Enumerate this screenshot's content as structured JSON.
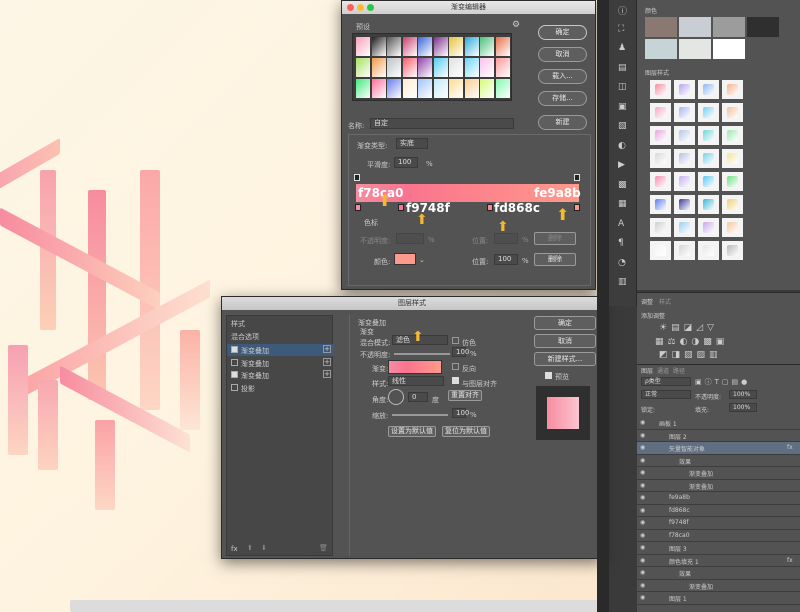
{
  "gradient_editor": {
    "title": "渐变编辑器",
    "presets_label": "预设",
    "name_label": "名称:",
    "name_value": "自定",
    "type_label": "渐变类型:",
    "type_value": "实底",
    "smooth_label": "平滑度:",
    "smooth_value": "100",
    "percent": "%",
    "btn_ok": "确定",
    "btn_cancel": "取消",
    "btn_load": "载入...",
    "btn_save": "存储...",
    "btn_new": "新建",
    "stops_label": "色标",
    "opacity_label": "不透明度:",
    "location_label": "位置:",
    "delete_label": "删除",
    "color_label": "颜色:",
    "location_value": "100",
    "overlay_left": "f78ca0",
    "overlay_right": "fe9a8b",
    "overlay_mid1": "f9748f",
    "overlay_mid2": "fd868c",
    "preset_colors": [
      "#f6a0b8",
      "#1e1e1e",
      "#555555",
      "#c94070",
      "#3b66d6",
      "#7d2f8f",
      "#e8c23a",
      "#2ca9d9",
      "#4cc07a",
      "#e7704e",
      "#a8e063",
      "#f2994a",
      "#bdc3c7",
      "#f45c6a",
      "#8e44ad",
      "#56ccf2",
      "#e1e1e1",
      "#6dd5fa",
      "#fbc2eb",
      "#ff9a9e",
      "#43e97b",
      "#fa709a",
      "#667eea",
      "#ffecd2",
      "#a1c4fd",
      "#c2e9fb",
      "#fddb92",
      "#fccb90",
      "#d4fc79",
      "#84fab0"
    ]
  },
  "layer_style": {
    "title": "图层样式",
    "styles_label": "样式",
    "blend_options": "混合选项",
    "items": [
      "渐变叠加",
      "渐变叠加",
      "渐变叠加",
      "投影"
    ],
    "section_title": "渐变叠加",
    "section_sub": "渐变",
    "blend_mode_label": "混合模式:",
    "blend_mode_value": "滤色",
    "dither_label": "仿色",
    "opacity_label": "不透明度:",
    "opacity_value": "100",
    "gradient_label": "渐变:",
    "reverse_label": "反向",
    "style_label": "样式:",
    "style_value": "线性",
    "align_label": "与图层对齐",
    "angle_label": "角度:",
    "angle_value": "0",
    "degree": "度",
    "reset_align": "重置对齐",
    "scale_label": "缩放:",
    "scale_value": "100",
    "percent": "%",
    "btn_default": "设置为默认值",
    "btn_reset_default": "复位为默认值",
    "btn_ok": "确定",
    "btn_cancel": "取消",
    "btn_new_style": "新建样式...",
    "preview_label": "预览",
    "fx_label": "fx"
  },
  "swatches_panel": {
    "title": "颜色",
    "styles_title": "图层样式",
    "swatch_colors": [
      "#8a7872",
      "#c9cdd4",
      "#9c9c9c",
      "#2f2f2f",
      "#c6d4d8",
      "#e4e6e4",
      "#ffffff"
    ],
    "style_colors": [
      "#f78ca0",
      "#b9a3f0",
      "#8fb8f0",
      "#f7b18b",
      "#f4a8c8",
      "#a7b7f0",
      "#76d0f0",
      "#f5c19a",
      "#e8a6e0",
      "#b6c6e6",
      "#6fd7d7",
      "#9ee8b0",
      "#d9d9d9",
      "#b7c1e8",
      "#7bd1ea",
      "#f6e39a",
      "#f88fb0",
      "#c6b0f0",
      "#5ec8f0",
      "#6fe08a",
      "#5a7cf0",
      "#3b3b9c",
      "#3bb7d8",
      "#f0d070",
      "#cfcfcf",
      "#9ad0f0",
      "#c8a8e8",
      "#f7c69a",
      "#f4f4f4",
      "#d6d6d6",
      "#e8e8e8",
      "#b8b8b8"
    ]
  },
  "adjustments": {
    "tab_active": "调整",
    "tab_other": "样式",
    "title": "添加调整"
  },
  "layers_panel": {
    "tabs": [
      "图层",
      "通道",
      "路径"
    ],
    "kind": "ρ类型",
    "mode": "正常",
    "opacity_label": "不透明度:",
    "opacity_value": "100%",
    "lock_label": "锁定:",
    "fill_label": "填充:",
    "fill_value": "100%",
    "rows": [
      {
        "name": "画板 1",
        "indent": 0
      },
      {
        "name": "图层 2",
        "indent": 1
      },
      {
        "name": "矢量智能对象",
        "indent": 1
      },
      {
        "name": "效果",
        "indent": 2
      },
      {
        "name": "渐变叠加",
        "indent": 3
      },
      {
        "name": "渐变叠加",
        "indent": 3
      },
      {
        "name": "fe9a8b",
        "indent": 1
      },
      {
        "name": "fd868c",
        "indent": 1
      },
      {
        "name": "f9748f",
        "indent": 1
      },
      {
        "name": "f78ca0",
        "indent": 1
      },
      {
        "name": "图层 3",
        "indent": 1
      },
      {
        "name": "颜色填充 1",
        "indent": 1
      },
      {
        "name": "效果",
        "indent": 2
      },
      {
        "name": "渐变叠加",
        "indent": 3
      },
      {
        "name": "图层 1",
        "indent": 1
      }
    ],
    "fx": "fx"
  }
}
